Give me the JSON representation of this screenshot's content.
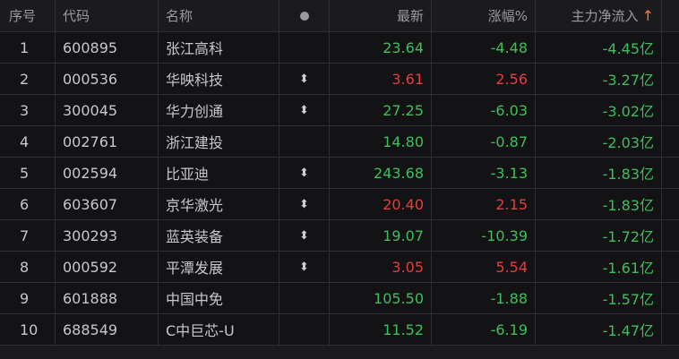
{
  "colors": {
    "background": "#131315",
    "header_bg": "#1b1b1e",
    "up": "#e73d3d",
    "down": "#3fbf5a",
    "sort_arrow": "#ff7a21"
  },
  "header": {
    "index": "序号",
    "code": "代码",
    "name": "名称",
    "dot_icon": "dot-icon",
    "price": "最新",
    "change_pct": "涨幅%",
    "main_net_inflow": "主力净流入",
    "sort_arrow": "↑"
  },
  "rows": [
    {
      "index": "1",
      "code": "600895",
      "name": "张江高科",
      "updown": "",
      "price": "23.64",
      "change": "-4.48",
      "inflow": "-4.45亿",
      "price_trend": "down",
      "change_trend": "down"
    },
    {
      "index": "2",
      "code": "000536",
      "name": "华映科技",
      "updown": "⬍",
      "price": "3.61",
      "change": "2.56",
      "inflow": "-3.27亿",
      "price_trend": "up",
      "change_trend": "up"
    },
    {
      "index": "3",
      "code": "300045",
      "name": "华力创通",
      "updown": "⬍",
      "price": "27.25",
      "change": "-6.03",
      "inflow": "-3.02亿",
      "price_trend": "down",
      "change_trend": "down"
    },
    {
      "index": "4",
      "code": "002761",
      "name": "浙江建投",
      "updown": "",
      "price": "14.80",
      "change": "-0.87",
      "inflow": "-2.03亿",
      "price_trend": "down",
      "change_trend": "down"
    },
    {
      "index": "5",
      "code": "002594",
      "name": "比亚迪",
      "updown": "⬍",
      "price": "243.68",
      "change": "-3.13",
      "inflow": "-1.83亿",
      "price_trend": "down",
      "change_trend": "down"
    },
    {
      "index": "6",
      "code": "603607",
      "name": "京华激光",
      "updown": "⬍",
      "price": "20.40",
      "change": "2.15",
      "inflow": "-1.83亿",
      "price_trend": "up",
      "change_trend": "up"
    },
    {
      "index": "7",
      "code": "300293",
      "name": "蓝英装备",
      "updown": "⬍",
      "price": "19.07",
      "change": "-10.39",
      "inflow": "-1.72亿",
      "price_trend": "down",
      "change_trend": "down"
    },
    {
      "index": "8",
      "code": "000592",
      "name": "平潭发展",
      "updown": "⬍",
      "price": "3.05",
      "change": "5.54",
      "inflow": "-1.61亿",
      "price_trend": "up",
      "change_trend": "up"
    },
    {
      "index": "9",
      "code": "601888",
      "name": "中国中免",
      "updown": "",
      "price": "105.50",
      "change": "-1.88",
      "inflow": "-1.57亿",
      "price_trend": "down",
      "change_trend": "down"
    },
    {
      "index": "10",
      "code": "688549",
      "name": "C中巨芯-U",
      "updown": "",
      "price": "11.52",
      "change": "-6.19",
      "inflow": "-1.47亿",
      "price_trend": "down",
      "change_trend": "down"
    }
  ]
}
